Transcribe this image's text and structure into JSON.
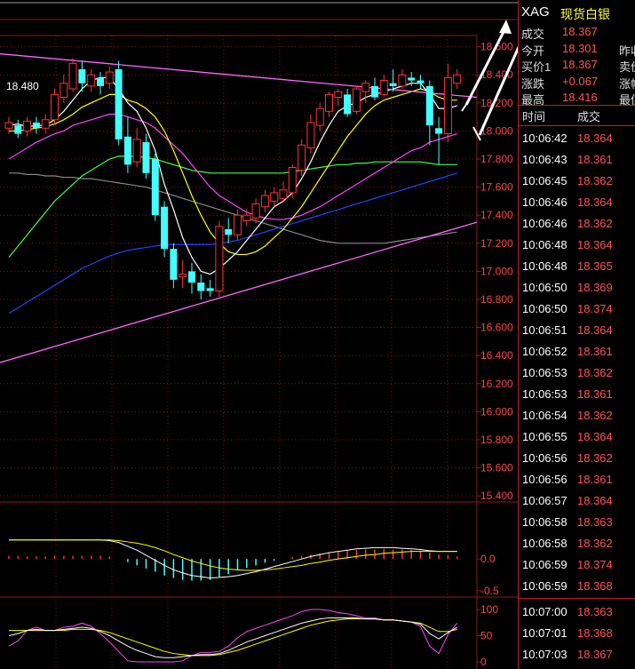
{
  "axis_labels": {
    "main": [
      "18.600",
      "18.400",
      "18.200",
      "18.000",
      "17.800",
      "17.600",
      "17.400",
      "17.200",
      "17.000",
      "16.800",
      "16.600",
      "16.400",
      "16.200",
      "16.000",
      "15.800",
      "15.600",
      "15.400"
    ],
    "macd": [
      "0.0",
      "-0.5"
    ],
    "kdj": [
      "100",
      "50",
      "0"
    ]
  },
  "last_close_label": "18.480",
  "header": {
    "symbol": "XAG",
    "name": "现货白银"
  },
  "quote": [
    {
      "label": "成交",
      "value": "18.367",
      "extra": ""
    },
    {
      "label": "今开",
      "value": "18.301",
      "extra": "昨收"
    },
    {
      "label": "买价1",
      "value": "18.367",
      "extra": "卖价"
    },
    {
      "label": "涨跌",
      "value": "+0.067",
      "extra": "涨幅"
    },
    {
      "label": "最高",
      "value": "18.416",
      "extra": "最低"
    }
  ],
  "tick_header": {
    "time": "时间",
    "price": "成交"
  },
  "ticks": [
    {
      "time": "10:06:42",
      "price": "18.364"
    },
    {
      "time": "10:06:43",
      "price": "18.361"
    },
    {
      "time": "10:06:45",
      "price": "18.362"
    },
    {
      "time": "10:06:46",
      "price": "18.364"
    },
    {
      "time": "10:06:46",
      "price": "18.362"
    },
    {
      "time": "10:06:48",
      "price": "18.364"
    },
    {
      "time": "10:06:48",
      "price": "18.365"
    },
    {
      "time": "10:06:50",
      "price": "18.369"
    },
    {
      "time": "10:06:50",
      "price": "18.374"
    },
    {
      "time": "10:06:51",
      "price": "18.364"
    },
    {
      "time": "10:06:52",
      "price": "18.361"
    },
    {
      "time": "10:06:53",
      "price": "18.362"
    },
    {
      "time": "10:06:53",
      "price": "18.361"
    },
    {
      "time": "10:06:54",
      "price": "18.362"
    },
    {
      "time": "10:06:55",
      "price": "18.364"
    },
    {
      "time": "10:06:56",
      "price": "18.362"
    },
    {
      "time": "10:06:56",
      "price": "18.361"
    },
    {
      "time": "10:06:57",
      "price": "18.364"
    },
    {
      "time": "10:06:58",
      "price": "18.363"
    },
    {
      "time": "10:06:58",
      "price": "18.362"
    },
    {
      "time": "10:06:59",
      "price": "18.374"
    },
    {
      "time": "10:06:59",
      "price": "18.368"
    },
    {
      "time": "10:07:00",
      "price": "18.363"
    },
    {
      "time": "10:07:01",
      "price": "18.368"
    },
    {
      "time": "10:07:03",
      "price": "18.367"
    }
  ],
  "colors": {
    "up": "#ff3333",
    "down": "#44ffff",
    "grid": "#8b1a1a",
    "ma5": "#ffffff",
    "ma10": "#ffff00",
    "ma20": "#ff44ff",
    "ma30": "#44ff44",
    "ma60": "#2244ff",
    "ma120": "#888888"
  },
  "candles": [
    [
      18.02,
      18.06,
      17.98,
      18.1
    ],
    [
      18.04,
      17.98,
      17.95,
      18.08
    ],
    [
      18.0,
      18.07,
      17.96,
      18.1
    ],
    [
      18.06,
      18.02,
      17.98,
      18.1
    ],
    [
      18.02,
      18.08,
      17.98,
      18.12
    ],
    [
      18.08,
      18.26,
      18.05,
      18.3
    ],
    [
      18.24,
      18.34,
      18.2,
      18.4
    ],
    [
      18.3,
      18.48,
      18.28,
      18.52
    ],
    [
      18.44,
      18.34,
      18.28,
      18.5
    ],
    [
      18.32,
      18.4,
      18.28,
      18.44
    ],
    [
      18.38,
      18.32,
      18.26,
      18.42
    ],
    [
      18.34,
      18.42,
      18.3,
      18.46
    ],
    [
      18.44,
      17.94,
      17.9,
      18.5
    ],
    [
      17.96,
      17.76,
      17.7,
      18.1
    ],
    [
      17.78,
      17.94,
      17.74,
      18.02
    ],
    [
      17.92,
      17.7,
      17.66,
      17.98
    ],
    [
      17.8,
      17.4,
      17.36,
      17.84
    ],
    [
      17.46,
      17.16,
      17.1,
      17.5
    ],
    [
      17.16,
      16.94,
      16.88,
      17.2
    ],
    [
      16.96,
      16.98,
      16.88,
      17.08
    ],
    [
      17.0,
      16.92,
      16.84,
      17.06
    ],
    [
      16.92,
      16.86,
      16.8,
      16.98
    ],
    [
      16.88,
      16.86,
      16.82,
      16.94
    ],
    [
      16.86,
      17.32,
      16.82,
      17.36
    ],
    [
      17.3,
      17.26,
      17.2,
      17.38
    ],
    [
      17.26,
      17.4,
      17.22,
      17.44
    ],
    [
      17.36,
      17.4,
      17.32,
      17.44
    ],
    [
      17.38,
      17.48,
      17.34,
      17.52
    ],
    [
      17.46,
      17.54,
      17.42,
      17.58
    ],
    [
      17.5,
      17.56,
      17.46,
      17.6
    ],
    [
      17.52,
      17.58,
      17.5,
      17.64
    ],
    [
      17.56,
      17.74,
      17.52,
      17.76
    ],
    [
      17.72,
      17.9,
      17.68,
      17.94
    ],
    [
      17.88,
      18.06,
      17.84,
      18.12
    ],
    [
      18.04,
      18.16,
      18.0,
      18.2
    ],
    [
      18.14,
      18.26,
      18.1,
      18.28
    ],
    [
      18.24,
      18.28,
      18.18,
      18.3
    ],
    [
      18.26,
      18.12,
      18.1,
      18.3
    ],
    [
      18.14,
      18.3,
      18.12,
      18.32
    ],
    [
      18.28,
      18.34,
      18.2,
      18.36
    ],
    [
      18.32,
      18.24,
      18.22,
      18.38
    ],
    [
      18.26,
      18.36,
      18.24,
      18.4
    ],
    [
      18.34,
      18.32,
      18.28,
      18.44
    ],
    [
      18.32,
      18.4,
      18.3,
      18.44
    ],
    [
      18.38,
      18.36,
      18.32,
      18.42
    ],
    [
      18.36,
      18.34,
      18.3,
      18.4
    ],
    [
      18.32,
      18.04,
      17.9,
      18.36
    ],
    [
      18.02,
      17.98,
      17.76,
      18.1
    ],
    [
      17.98,
      18.38,
      17.92,
      18.48
    ],
    [
      18.34,
      18.4,
      18.3,
      18.44
    ]
  ],
  "ma": {
    "ma5": [
      18.04,
      18.05,
      18.03,
      18.04,
      18.04,
      18.08,
      18.14,
      18.22,
      18.3,
      18.36,
      18.38,
      18.38,
      18.3,
      18.2,
      18.14,
      18.02,
      17.86,
      17.62,
      17.44,
      17.24,
      17.1,
      17.0,
      16.98,
      17.02,
      17.08,
      17.14,
      17.22,
      17.3,
      17.38,
      17.46,
      17.5,
      17.56,
      17.66,
      17.78,
      17.92,
      18.04,
      18.14,
      18.18,
      18.2,
      18.24,
      18.26,
      18.28,
      18.3,
      18.32,
      18.34,
      18.34,
      18.26,
      18.16,
      18.16,
      18.18
    ],
    "ma10": [
      18.0,
      18.0,
      18.01,
      18.02,
      18.03,
      18.05,
      18.08,
      18.12,
      18.17,
      18.2,
      18.23,
      18.26,
      18.26,
      18.22,
      18.2,
      18.16,
      18.1,
      18.0,
      17.86,
      17.7,
      17.54,
      17.4,
      17.28,
      17.2,
      17.14,
      17.12,
      17.12,
      17.14,
      17.18,
      17.24,
      17.3,
      17.38,
      17.46,
      17.56,
      17.66,
      17.76,
      17.86,
      17.96,
      18.04,
      18.12,
      18.18,
      18.22,
      18.24,
      18.26,
      18.28,
      18.3,
      18.28,
      18.24,
      18.22,
      18.22
    ],
    "ma20": [
      17.8,
      17.84,
      17.88,
      17.92,
      17.95,
      17.98,
      18.0,
      18.04,
      18.06,
      18.08,
      18.1,
      18.12,
      18.12,
      18.1,
      18.08,
      18.06,
      18.02,
      17.96,
      17.9,
      17.84,
      17.76,
      17.68,
      17.6,
      17.54,
      17.5,
      17.46,
      17.42,
      17.4,
      17.38,
      17.37,
      17.37,
      17.38,
      17.4,
      17.43,
      17.46,
      17.5,
      17.54,
      17.58,
      17.62,
      17.66,
      17.7,
      17.74,
      17.78,
      17.82,
      17.86,
      17.88,
      17.92,
      17.94,
      17.96,
      17.98
    ],
    "ma30": [
      17.1,
      17.18,
      17.26,
      17.34,
      17.42,
      17.5,
      17.56,
      17.62,
      17.68,
      17.72,
      17.76,
      17.8,
      17.82,
      17.82,
      17.82,
      17.81,
      17.8,
      17.78,
      17.76,
      17.74,
      17.72,
      17.71,
      17.7,
      17.7,
      17.7,
      17.7,
      17.7,
      17.7,
      17.7,
      17.7,
      17.7,
      17.71,
      17.72,
      17.73,
      17.74,
      17.75,
      17.76,
      17.76,
      17.77,
      17.77,
      17.78,
      17.78,
      17.78,
      17.78,
      17.78,
      17.78,
      17.77,
      17.76,
      17.76,
      17.76
    ],
    "ma60": [
      16.7,
      16.74,
      16.78,
      16.82,
      16.86,
      16.9,
      16.94,
      16.98,
      17.02,
      17.05,
      17.08,
      17.11,
      17.13,
      17.15,
      17.16,
      17.17,
      17.18,
      17.19,
      17.19,
      17.19,
      17.19,
      17.19,
      17.19,
      17.2,
      17.21,
      17.22,
      17.24,
      17.26,
      17.28,
      17.3,
      17.32,
      17.34,
      17.36,
      17.38,
      17.4,
      17.42,
      17.44,
      17.46,
      17.48,
      17.5,
      17.52,
      17.54,
      17.56,
      17.58,
      17.6,
      17.62,
      17.64,
      17.66,
      17.68,
      17.7
    ],
    "ma120": [
      17.7,
      17.7,
      17.69,
      17.69,
      17.68,
      17.68,
      17.67,
      17.67,
      17.66,
      17.66,
      17.65,
      17.64,
      17.63,
      17.62,
      17.61,
      17.6,
      17.58,
      17.56,
      17.54,
      17.52,
      17.5,
      17.48,
      17.46,
      17.44,
      17.42,
      17.4,
      17.38,
      17.36,
      17.34,
      17.32,
      17.3,
      17.28,
      17.26,
      17.24,
      17.22,
      17.21,
      17.2,
      17.2,
      17.2,
      17.2,
      17.2,
      17.2,
      17.21,
      17.22,
      17.23,
      17.24,
      17.25,
      17.26,
      17.27,
      17.28
    ]
  },
  "macd": {
    "hist": [
      0.05,
      0.05,
      0.04,
      0.04,
      0.04,
      0.05,
      0.05,
      0.05,
      0.05,
      0.05,
      0.05,
      0.04,
      0.0,
      -0.05,
      -0.1,
      -0.15,
      -0.2,
      -0.26,
      -0.3,
      -0.33,
      -0.34,
      -0.34,
      -0.33,
      -0.28,
      -0.24,
      -0.18,
      -0.14,
      -0.1,
      -0.06,
      -0.03,
      0.0,
      0.03,
      0.05,
      0.07,
      0.09,
      0.11,
      0.12,
      0.13,
      0.14,
      0.15,
      0.15,
      0.16,
      0.15,
      0.15,
      0.14,
      0.13,
      0.1,
      0.07,
      0.06,
      0.04
    ],
    "dif": [
      0.3,
      0.3,
      0.3,
      0.3,
      0.3,
      0.3,
      0.3,
      0.3,
      0.3,
      0.3,
      0.3,
      0.29,
      0.26,
      0.2,
      0.14,
      0.06,
      -0.02,
      -0.1,
      -0.17,
      -0.22,
      -0.26,
      -0.28,
      -0.3,
      -0.29,
      -0.28,
      -0.26,
      -0.23,
      -0.2,
      -0.16,
      -0.12,
      -0.08,
      -0.04,
      0.0,
      0.04,
      0.07,
      0.1,
      0.12,
      0.14,
      0.16,
      0.17,
      0.18,
      0.18,
      0.18,
      0.17,
      0.16,
      0.15,
      0.13,
      0.12,
      0.12,
      0.12
    ],
    "dea": [
      0.3,
      0.3,
      0.3,
      0.3,
      0.3,
      0.3,
      0.3,
      0.3,
      0.3,
      0.3,
      0.3,
      0.3,
      0.29,
      0.27,
      0.25,
      0.22,
      0.18,
      0.13,
      0.07,
      0.02,
      -0.03,
      -0.07,
      -0.11,
      -0.14,
      -0.16,
      -0.17,
      -0.18,
      -0.18,
      -0.17,
      -0.16,
      -0.14,
      -0.12,
      -0.1,
      -0.07,
      -0.05,
      -0.02,
      0.0,
      0.02,
      0.04,
      0.06,
      0.07,
      0.09,
      0.1,
      0.11,
      0.12,
      0.12,
      0.12,
      0.12,
      0.12,
      0.12
    ]
  },
  "kdj": {
    "k": [
      50,
      54,
      60,
      62,
      60,
      60,
      62,
      64,
      66,
      64,
      58,
      50,
      40,
      30,
      22,
      16,
      10,
      8,
      8,
      10,
      12,
      14,
      14,
      16,
      22,
      30,
      38,
      44,
      50,
      56,
      62,
      68,
      74,
      78,
      82,
      84,
      84,
      84,
      84,
      82,
      82,
      80,
      80,
      78,
      76,
      72,
      54,
      44,
      56,
      66
    ],
    "d": [
      60,
      60,
      60,
      60,
      60,
      60,
      60,
      62,
      62,
      62,
      60,
      56,
      50,
      44,
      38,
      32,
      26,
      20,
      16,
      14,
      12,
      12,
      12,
      14,
      18,
      22,
      28,
      34,
      40,
      46,
      52,
      58,
      64,
      70,
      74,
      78,
      80,
      82,
      82,
      82,
      82,
      80,
      80,
      78,
      76,
      74,
      66,
      58,
      58,
      62
    ],
    "j": [
      30,
      40,
      60,
      66,
      60,
      60,
      66,
      68,
      74,
      68,
      54,
      38,
      20,
      2,
      0,
      0,
      0,
      0,
      0,
      2,
      12,
      18,
      18,
      20,
      30,
      46,
      58,
      64,
      70,
      76,
      82,
      88,
      96,
      100,
      100,
      98,
      94,
      92,
      88,
      84,
      84,
      80,
      80,
      78,
      76,
      68,
      30,
      16,
      52,
      74
    ]
  }
}
